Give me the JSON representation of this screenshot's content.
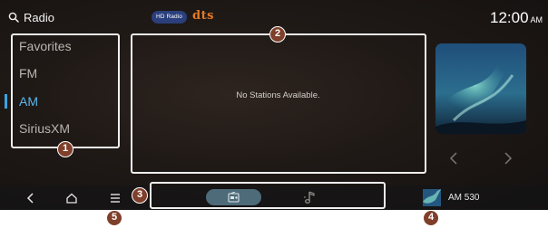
{
  "header": {
    "title": "Radio",
    "search_icon": "search-icon",
    "hd_radio_label": "HD Radio",
    "dts_label": "dts",
    "clock": {
      "time": "12:00",
      "ampm": "AM"
    }
  },
  "bands": [
    {
      "label": "Favorites",
      "selected": false
    },
    {
      "label": "FM",
      "selected": false
    },
    {
      "label": "AM",
      "selected": true
    },
    {
      "label": "SiriusXM",
      "selected": false
    }
  ],
  "stations": {
    "empty_message": "No Stations Available."
  },
  "album_art": {
    "prev_icon": "chevron-left-icon",
    "next_icon": "chevron-right-icon"
  },
  "bottom_bar": {
    "icons": [
      "back-icon",
      "home-icon",
      "menu-icon",
      "radio-icon",
      "music-note-icon"
    ],
    "now_playing": "AM 530"
  },
  "callouts": [
    "1",
    "2",
    "3",
    "4",
    "5"
  ],
  "colors": {
    "accent": "#5bb6ea",
    "callout": "#7f3f2a",
    "hd_badge": "#2a3f7c",
    "dts": "#e57a22"
  }
}
